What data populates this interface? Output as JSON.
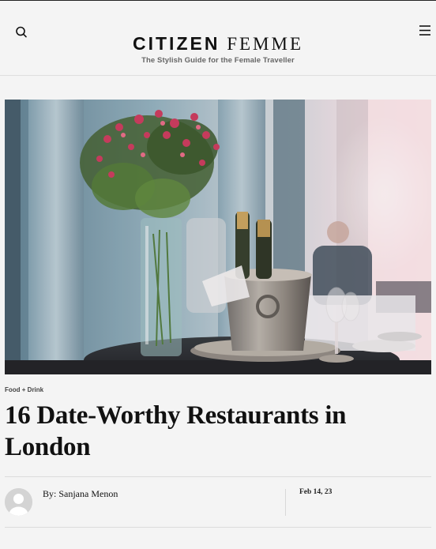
{
  "header": {
    "logo_bold": "CITIZEN",
    "logo_light": "FEMME",
    "tagline": "The Stylish Guide for the Female Traveller",
    "search_icon": "search-icon",
    "menu_icon": "hamburger-menu-icon"
  },
  "article": {
    "hero_image": "restaurant-table-roses-champagne-bucket-photo",
    "category": "Food + Drink",
    "title": "16 Date-Worthy Restaurants in London",
    "byline_prefix": "By:",
    "author": "Sanjana Menon",
    "date": "Feb 14, 23",
    "avatar_icon": "default-avatar-icon"
  },
  "colors": {
    "background": "#f4f4f4",
    "text": "#111111",
    "divider": "#dcdcdc"
  }
}
